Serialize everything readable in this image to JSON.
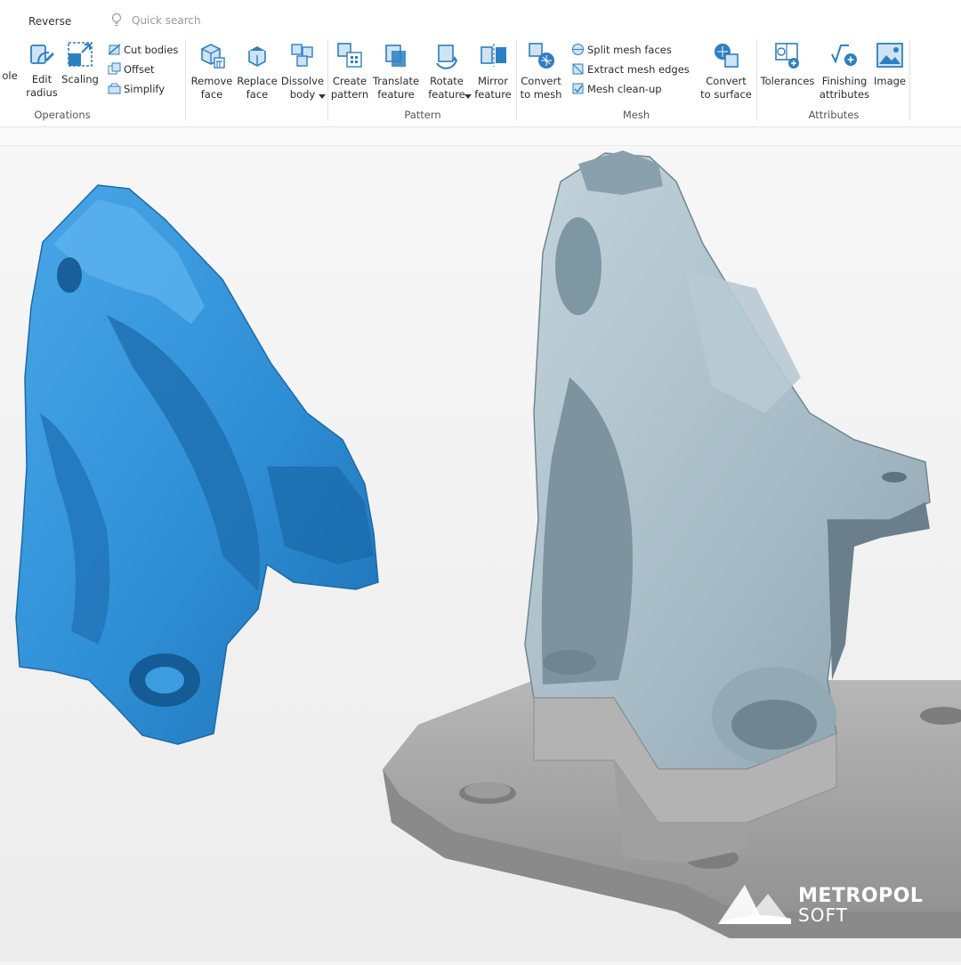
{
  "app": {
    "tab_reverse": "Reverse",
    "quick_search_placeholder": "Quick search"
  },
  "ribbon": {
    "operations": {
      "group_label": "Operations",
      "hole_fragment": "ole",
      "edit_radius": "Edit\nradius",
      "scaling": "Scaling",
      "cut_bodies": "Cut bodies",
      "offset": "Offset",
      "simplify": "Simplify"
    },
    "face_tools": {
      "remove_face": "Remove\nface",
      "replace_face": "Replace\nface",
      "dissolve_body": "Dissolve\nbody"
    },
    "pattern": {
      "group_label": "Pattern",
      "create_pattern": "Create\npattern",
      "translate_feature": "Translate\nfeature",
      "rotate_feature": "Rotate\nfeature",
      "mirror_feature": "Mirror\nfeature"
    },
    "mesh": {
      "group_label": "Mesh",
      "convert_to_mesh": "Convert\nto mesh",
      "split_mesh_faces": "Split mesh faces",
      "extract_mesh_edges": "Extract mesh edges",
      "mesh_cleanup": "Mesh clean-up",
      "convert_to_surface": "Convert\nto surface"
    },
    "attributes": {
      "group_label": "Attributes",
      "tolerances": "Tolerances",
      "finishing_attributes": "Finishing\nattributes",
      "image": "Image"
    }
  },
  "logo": {
    "line1": "METROPOL",
    "line2": "SOFT"
  },
  "colors": {
    "icon_blue": "#2d7fc1",
    "scan_mesh_blue": "#2f8fd6",
    "cad_steel": "#a9bcc6",
    "base_gray": "#a8a8a8"
  }
}
